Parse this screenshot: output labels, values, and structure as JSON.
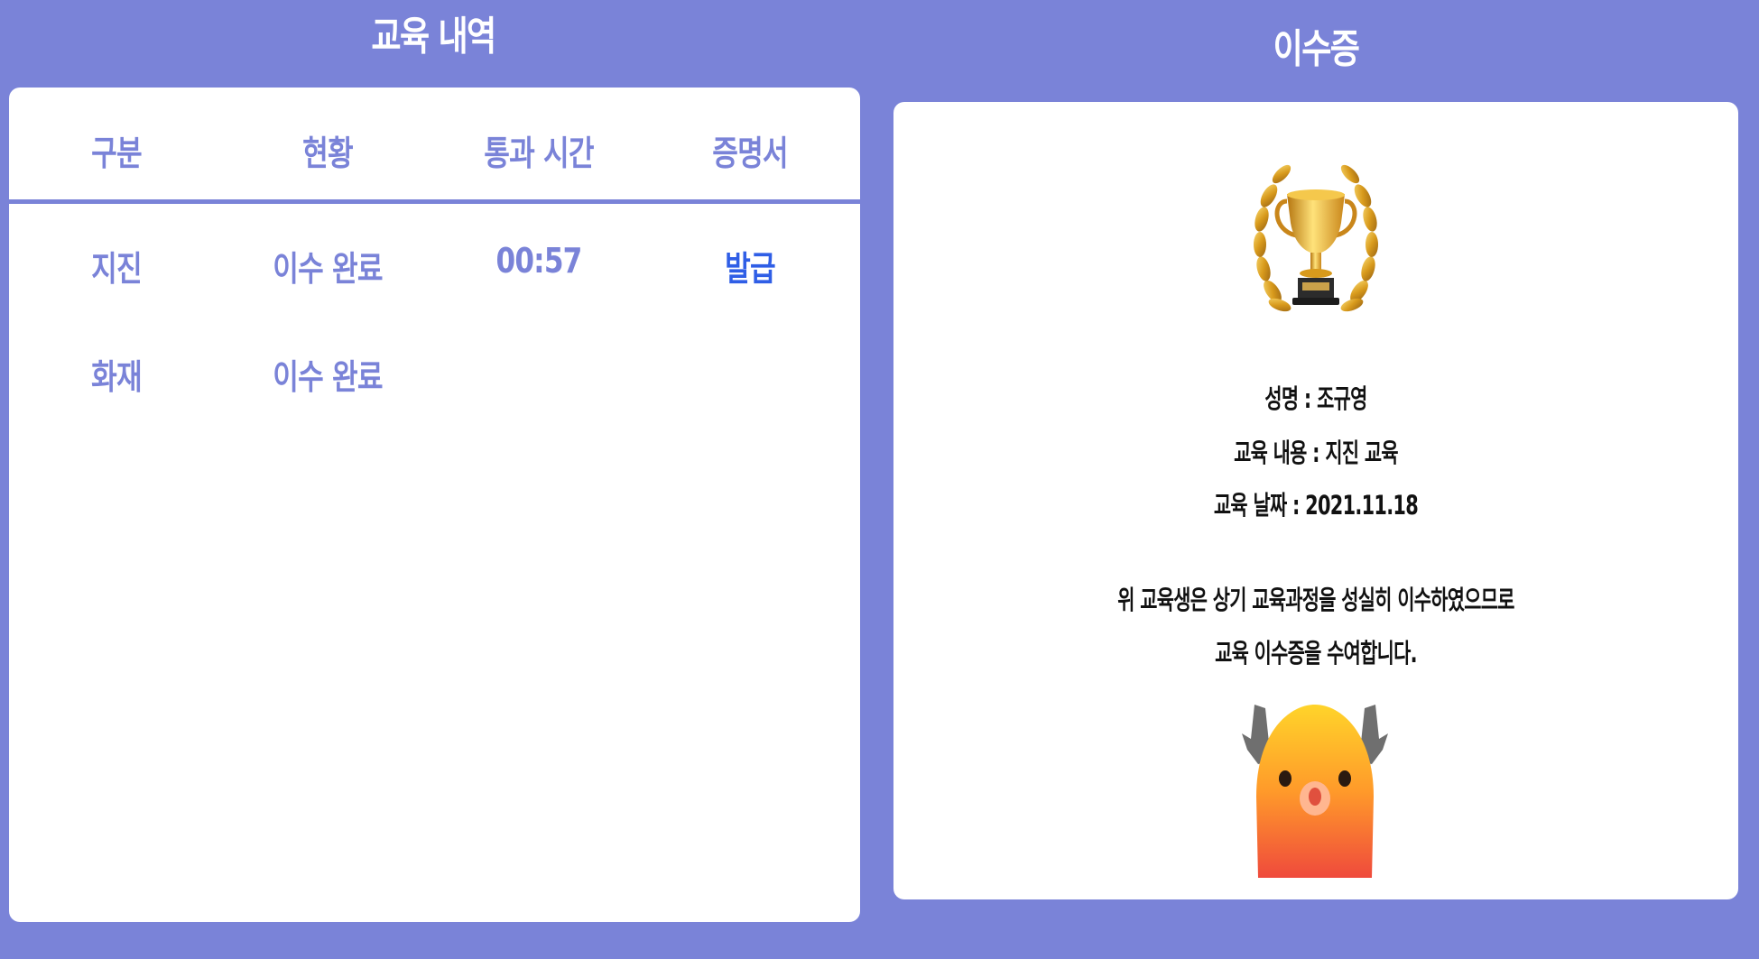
{
  "history": {
    "title": "교육 내역",
    "columns": [
      "구분",
      "현황",
      "통과 시간",
      "증명서"
    ],
    "rows": [
      {
        "category": "지진",
        "status": "이수 완료",
        "time": "00:57",
        "certificate": "발급"
      },
      {
        "category": "화재",
        "status": "이수 완료",
        "time": "",
        "certificate": ""
      }
    ]
  },
  "certificate": {
    "title": "이수증",
    "name_line": "성명 : 조규영",
    "course_line": "교육 내용 : 지진 교육",
    "date_line": "교육 날짜 : 2021.11.18",
    "message_line1": "위 교육생은 상기 교육과정을 성실히 이수하였으므로",
    "message_line2": "교육 이수증을 수여합니다.",
    "trophy_icon": "trophy-with-laurel-icon",
    "mascot_icon": "mascot-character-icon"
  },
  "colors": {
    "background": "#7a83d8",
    "panel": "#ffffff",
    "header_text": "#7a83d8",
    "link": "#2f5ee6",
    "body_text": "#111111"
  }
}
